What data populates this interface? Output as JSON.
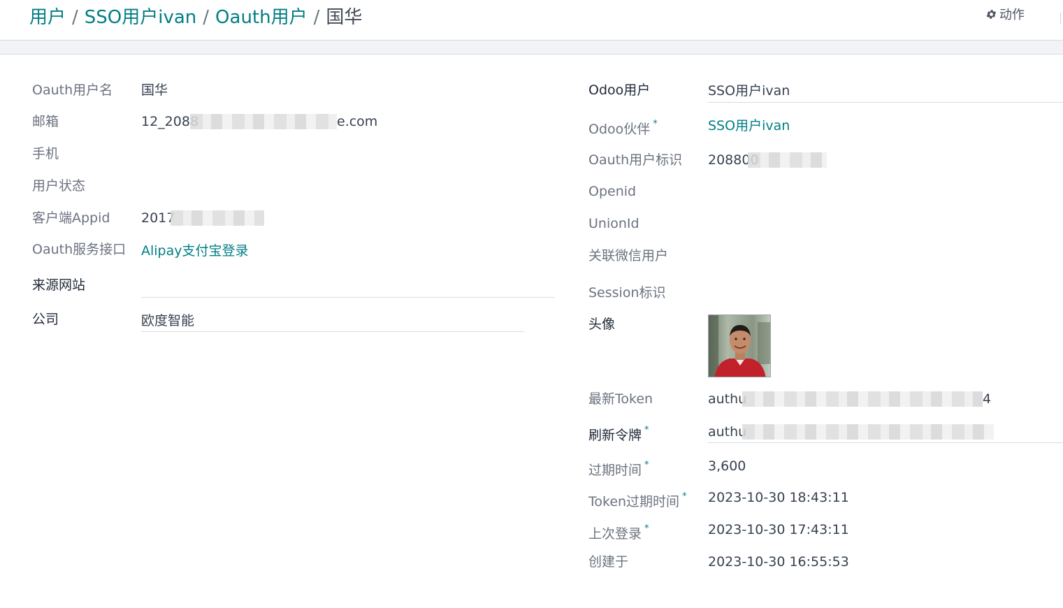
{
  "breadcrumb": {
    "items": [
      "用户",
      "SSO用户ivan",
      "Oauth用户"
    ],
    "separator": "/",
    "current": "国华"
  },
  "toolbar": {
    "action_label": "动作"
  },
  "left": {
    "oauth_username": {
      "label": "Oauth用户名",
      "value": "国华"
    },
    "email": {
      "label": "邮箱",
      "value_prefix": "12_2088",
      "value_suffix": "e.com"
    },
    "mobile": {
      "label": "手机",
      "value": ""
    },
    "user_status": {
      "label": "用户状态",
      "value": ""
    },
    "client_appid": {
      "label": "客户端Appid",
      "value_prefix": "2017"
    },
    "oauth_service": {
      "label": "Oauth服务接口",
      "value": "Alipay支付宝登录"
    },
    "source_site": {
      "label": "来源网站",
      "value": ""
    },
    "company": {
      "label": "公司",
      "value": "欧度智能"
    }
  },
  "right": {
    "odoo_user": {
      "label": "Odoo用户",
      "value": "SSO用户ivan"
    },
    "odoo_partner": {
      "label": "Odoo伙伴",
      "required_mark": "*",
      "value": "SSO用户ivan"
    },
    "oauth_user_id": {
      "label": "Oauth用户标识",
      "value_prefix": "208800"
    },
    "openid": {
      "label": "Openid",
      "value": ""
    },
    "unionid": {
      "label": "UnionId",
      "value": ""
    },
    "wechat_user": {
      "label": "关联微信用户",
      "value": ""
    },
    "session_id": {
      "label": "Session标识",
      "value": ""
    },
    "avatar": {
      "label": "头像"
    },
    "latest_token": {
      "label": "最新Token",
      "value_prefix": "authu",
      "value_suffix": "4"
    },
    "refresh_token": {
      "label": "刷新令牌",
      "required_mark": "*",
      "value_prefix": "authu"
    },
    "expires_in": {
      "label": "过期时间",
      "required_mark": "*",
      "value": "3,600"
    },
    "token_expire_time": {
      "label": "Token过期时间",
      "required_mark": "*",
      "value": "2023-10-30 18:43:11"
    },
    "last_login": {
      "label": "上次登录",
      "required_mark": "*",
      "value": "2023-10-30 17:43:11"
    },
    "created_at": {
      "label": "创建于",
      "value": "2023-10-30 16:55:53"
    }
  },
  "colors": {
    "link": "#017e84",
    "label": "#6b7280",
    "text": "#374151"
  },
  "icons": {
    "action": "gear-icon"
  }
}
